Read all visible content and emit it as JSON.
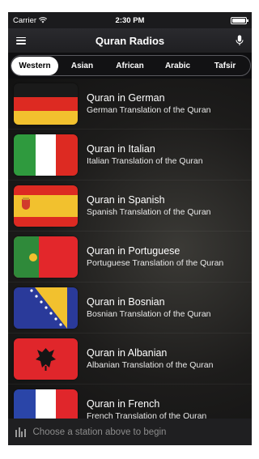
{
  "status_bar": {
    "carrier": "Carrier",
    "time": "2:30 PM"
  },
  "nav": {
    "title": "Quran Radios",
    "menu_icon": "hamburger-menu-icon",
    "mic_icon": "microphone-icon"
  },
  "tabs": [
    {
      "label": "Western",
      "active": true
    },
    {
      "label": "Asian",
      "active": false
    },
    {
      "label": "African",
      "active": false
    },
    {
      "label": "Arabic",
      "active": false
    },
    {
      "label": "Tafsir",
      "active": false
    }
  ],
  "stations": [
    {
      "title": "Quran in German",
      "subtitle": "German Translation of the Quran",
      "flag": "germany-flag"
    },
    {
      "title": "Quran in Italian",
      "subtitle": "Italian Translation of the Quran",
      "flag": "italy-flag"
    },
    {
      "title": "Quran in Spanish",
      "subtitle": "Spanish Translation of the Quran",
      "flag": "spain-flag"
    },
    {
      "title": "Quran in Portuguese",
      "subtitle": "Portuguese Translation of the Quran",
      "flag": "portugal-flag"
    },
    {
      "title": "Quran in Bosnian",
      "subtitle": "Bosnian Translation of the Quran",
      "flag": "bosnia-flag"
    },
    {
      "title": "Quran in Albanian",
      "subtitle": "Albanian Translation of the Quran",
      "flag": "albania-flag"
    },
    {
      "title": "Quran in French",
      "subtitle": "French Translation of the Quran",
      "flag": "france-flag"
    }
  ],
  "player": {
    "placeholder": "Choose a station above to begin",
    "icon": "equalizer-icon"
  },
  "colors": {
    "background": "#141414",
    "nav": "#2a2a2e",
    "accent_text": "#ffffff",
    "muted_text": "#8c8c8c"
  }
}
